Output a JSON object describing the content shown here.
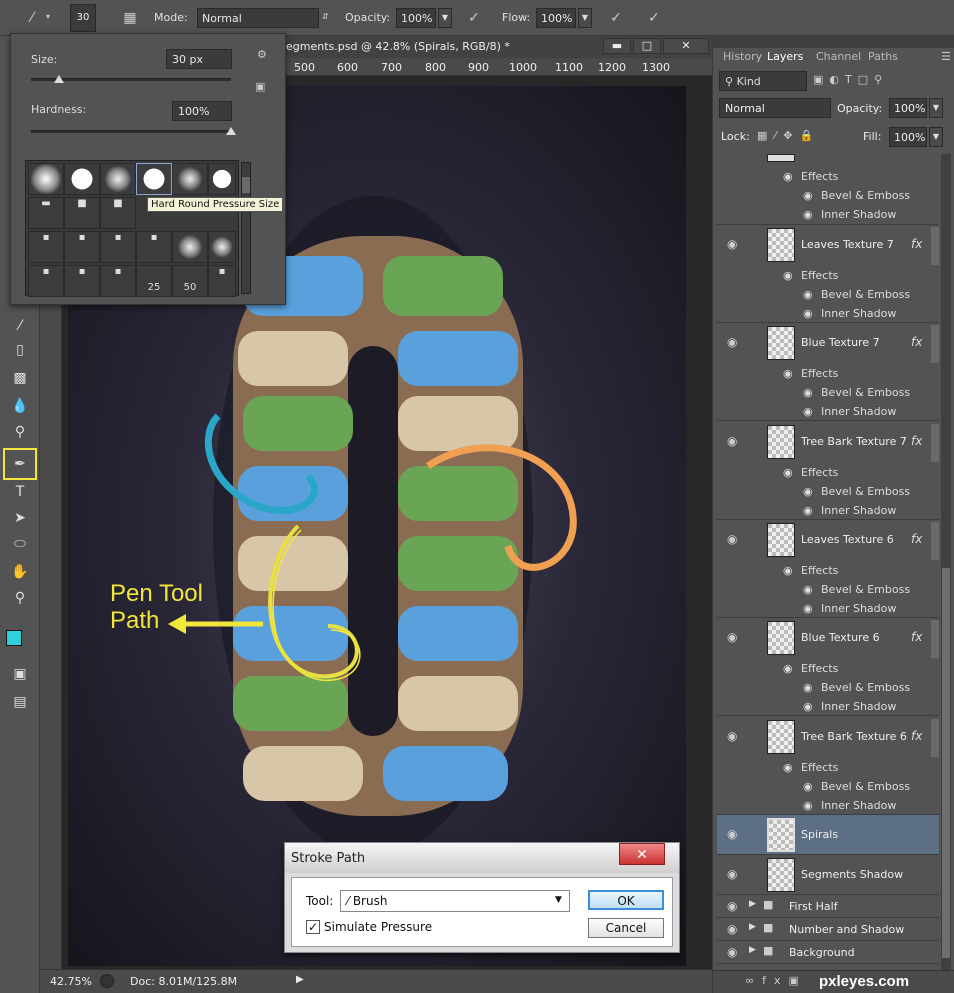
{
  "options_bar": {
    "brush_size_value": "30",
    "mode_label": "Mode:",
    "mode_value": "Normal",
    "opacity_label": "Opacity:",
    "opacity_value": "100%",
    "flow_label": "Flow:",
    "flow_value": "100%"
  },
  "document": {
    "tab_title": "egments.psd @ 42.8% (Spirals, RGB/8) *",
    "ruler_ticks": [
      "500",
      "600",
      "700",
      "800",
      "900",
      "1000",
      "1100",
      "1200",
      "1300"
    ],
    "zoom": "42.75%",
    "doc_info": "Doc: 8.01M/125.8M"
  },
  "brush_popup": {
    "size_label": "Size:",
    "size_value": "30 px",
    "hardness_label": "Hardness:",
    "hardness_value": "100%",
    "size_level_percent": 14,
    "hardness_level_percent": 100,
    "tooltip": "Hard Round Pressure Size",
    "tip_numbers": [
      "25",
      "50"
    ]
  },
  "annotation": {
    "line1": "Pen Tool",
    "line2": "Path"
  },
  "layers_panel": {
    "tabs": [
      "History",
      "Layers",
      "Channel",
      "Paths"
    ],
    "filter_kind": "Kind",
    "blend_mode": "Normal",
    "opacity_label": "Opacity:",
    "opacity_value": "100%",
    "lock_label": "Lock:",
    "fill_label": "Fill:",
    "fill_value": "100%",
    "effects_label": "Effects",
    "effect_bevel": "Bevel & Emboss",
    "effect_inner": "Inner Shadow",
    "layers": [
      "Leaves Texture 7",
      "Blue Texture 7",
      "Tree Bark Texture 7",
      "Leaves Texture 6",
      "Blue Texture 6",
      "Tree Bark Texture 6"
    ],
    "spirals": "Spirals",
    "segments_shadow": "Segments Shadow",
    "groups": [
      "First Half",
      "Number and Shadow",
      "Background"
    ]
  },
  "stroke_dialog": {
    "title": "Stroke Path",
    "tool_label": "Tool:",
    "tool_value": "Brush",
    "simulate_label": "Simulate Pressure",
    "simulate_checked": true,
    "ok_label": "OK",
    "cancel_label": "Cancel"
  },
  "watermark": "pxleyes.com",
  "colors": {
    "foreground": "#2fd0d8",
    "background": "#ffffff",
    "annotation": "#f2e63a",
    "highlight_layer": "#5d6f85"
  }
}
